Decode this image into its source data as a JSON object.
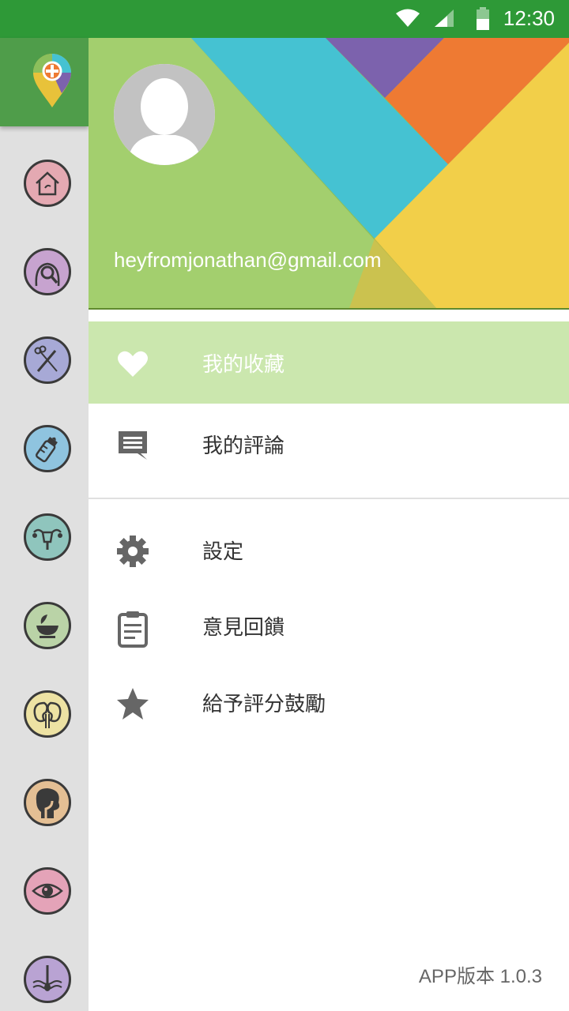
{
  "status_bar": {
    "time": "12:30",
    "colors": {
      "background": "#2e9937"
    }
  },
  "rail": {
    "logo_icon": "map-pin-plus-icon",
    "items": [
      {
        "icon": "home-care-icon",
        "color": "#e4a9b2"
      },
      {
        "icon": "body-check-icon",
        "color": "#c7a3cf"
      },
      {
        "icon": "surgery-tools-icon",
        "color": "#a7a9d6"
      },
      {
        "icon": "baby-bottle-icon",
        "color": "#8fc4df"
      },
      {
        "icon": "uterus-icon",
        "color": "#8fc5bd"
      },
      {
        "icon": "herb-mortar-icon",
        "color": "#bad3a7"
      },
      {
        "icon": "kidney-icon",
        "color": "#ede2a3"
      },
      {
        "icon": "head-throat-icon",
        "color": "#e4bf94"
      },
      {
        "icon": "eye-icon",
        "color": "#e4a3b8"
      },
      {
        "icon": "skin-hair-icon",
        "color": "#b9a3d3"
      }
    ]
  },
  "drawer": {
    "email": "heyfromjonathan@gmail.com",
    "menu": [
      {
        "label": "我的收藏",
        "icon": "heart-icon",
        "active": true
      },
      {
        "label": "我的評論",
        "icon": "comment-icon",
        "active": false
      },
      {
        "label": "設定",
        "icon": "gear-icon",
        "active": false
      },
      {
        "label": "意見回饋",
        "icon": "clipboard-icon",
        "active": false
      },
      {
        "label": "給予評分鼓勵",
        "icon": "star-icon",
        "active": false
      }
    ],
    "version": "APP版本 1.0.3"
  },
  "colors": {
    "accent_active": "#cbe7ae",
    "icon": "#666666",
    "header_green": "#8cbf5c",
    "header_cyan": "#45c2d2",
    "header_purple": "#7c62ad",
    "header_orange": "#ee7a33",
    "header_yellow": "#f2cf49"
  }
}
